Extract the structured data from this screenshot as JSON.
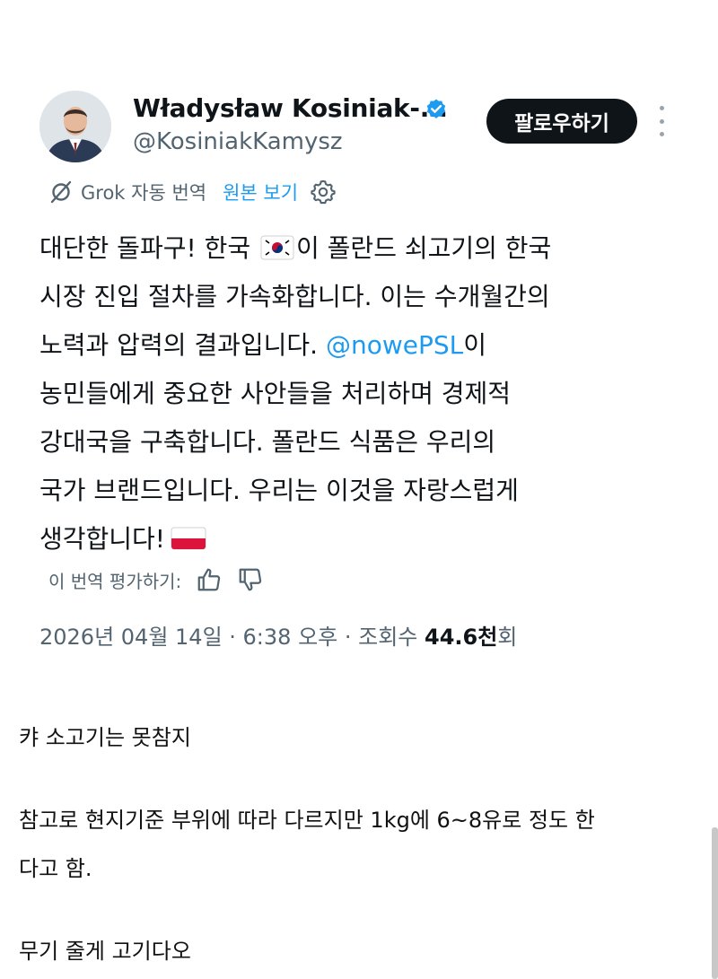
{
  "tweet": {
    "author_name": "Władysław Kosiniak-...",
    "handle": "@KosiniakKamysz",
    "follow_label": "팔로우하기",
    "translation": {
      "auto_label": "Grok 자동 번역",
      "view_original": "원본 보기"
    },
    "body": {
      "l1_a": "대단한 돌파구! 한국",
      "l1_b": "이 폴란드 쇠고기의 한국",
      "l2": "시장 진입 절차를 가속화합니다. 이는 수개월간의",
      "l3_a": "노력과 압력의 결과입니다.",
      "l3_mention": "@nowePSL",
      "l3_b": "이",
      "l4": "농민들에게 중요한 사안들을 처리하며 경제적",
      "l5": "강대국을 구축합니다. 폴란드 식품은 우리의",
      "l6": "국가 브랜드입니다. 우리는 이것을 자랑스럽게",
      "l7": "생각합니다!"
    },
    "rate_label": "이 번역 평가하기:",
    "meta": {
      "datetime": "2026년 04월 14일 · 6:38 오후 · 조회수",
      "views": "44.6천",
      "views_suffix": "회"
    },
    "colors": {
      "accent": "#1d9bf0",
      "text": "#0f1419",
      "secondary": "#536471",
      "follow_bg": "#0f1419"
    }
  },
  "comment": {
    "line1": "캬 소고기는 못참지",
    "line2": "참고로 현지기준 부위에 따라 다르지만 1kg에 6~8유로 정도 한",
    "line3": "다고 함.",
    "line4": "무기 줄게 고기다오"
  },
  "icons": {
    "verified": "verified-badge-icon",
    "more": "more-options-icon",
    "grok": "grok-icon",
    "settings": "gear-icon",
    "thumbs_up": "thumbs-up-icon",
    "thumbs_down": "thumbs-down-icon",
    "flag_korea": "south-korea-flag-icon",
    "flag_poland": "poland-flag-icon"
  }
}
